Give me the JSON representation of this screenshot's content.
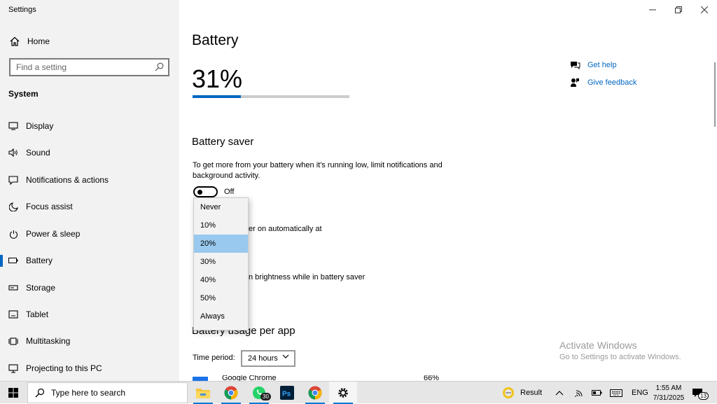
{
  "window": {
    "title": "Settings"
  },
  "sidebar": {
    "home_label": "Home",
    "search_placeholder": "Find a setting",
    "section_label": "System",
    "items": [
      {
        "label": "Display",
        "icon": "monitor-icon"
      },
      {
        "label": "Sound",
        "icon": "speaker-icon"
      },
      {
        "label": "Notifications & actions",
        "icon": "notification-icon"
      },
      {
        "label": "Focus assist",
        "icon": "moon-icon"
      },
      {
        "label": "Power & sleep",
        "icon": "power-icon"
      },
      {
        "label": "Battery",
        "icon": "battery-icon",
        "active": true
      },
      {
        "label": "Storage",
        "icon": "storage-icon"
      },
      {
        "label": "Tablet",
        "icon": "tablet-icon"
      },
      {
        "label": "Multitasking",
        "icon": "multitasking-icon"
      },
      {
        "label": "Projecting to this PC",
        "icon": "projector-icon"
      }
    ]
  },
  "main": {
    "title": "Battery",
    "battery_percent": "31%",
    "battery_level": 0.31,
    "battery_saver": {
      "heading": "Battery saver",
      "description": "To get more from your battery when it's running low, limit notifications and background activity.",
      "toggle_state": "Off",
      "auto_on_text_partial": "er on automatically at",
      "brightness_text_partial": "n brightness while in battery saver"
    },
    "usage": {
      "heading": "Battery usage per app",
      "period_label": "Time period:",
      "period_value": "24 hours",
      "first_app": {
        "name": "Google Chrome",
        "percent": "66%"
      }
    },
    "links": {
      "help": "Get help",
      "feedback": "Give feedback"
    },
    "watermark": {
      "line1": "Activate Windows",
      "line2": "Go to Settings to activate Windows."
    }
  },
  "dropdown": {
    "options": [
      "Never",
      "10%",
      "20%",
      "30%",
      "40%",
      "50%",
      "Always"
    ],
    "selected": "20%"
  },
  "taskbar": {
    "search_placeholder": "Type here to search",
    "whatsapp_badge": "30",
    "weather_label": "Result",
    "language": "ENG",
    "time": "1:55 AM",
    "date": "7/31/2025",
    "notification_count": "13"
  },
  "colors": {
    "accent": "#0067c0",
    "selected_option": "#99c9ef",
    "sidebar_bg": "#f2f2f2"
  }
}
